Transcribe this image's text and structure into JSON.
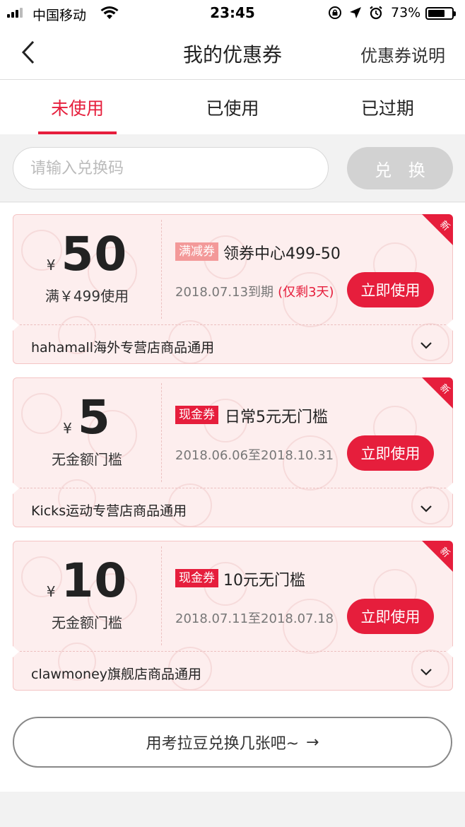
{
  "status_bar": {
    "carrier": "中国移动",
    "time": "23:45",
    "battery_percent": "73%",
    "battery_level": 0.73
  },
  "nav": {
    "title": "我的优惠券",
    "right_label": "优惠券说明",
    "back_icon": "chevron-left-icon"
  },
  "tabs": [
    {
      "label": "未使用",
      "active": true
    },
    {
      "label": "已使用",
      "active": false
    },
    {
      "label": "已过期",
      "active": false
    }
  ],
  "redeem": {
    "placeholder": "请输入兑换码",
    "value": "",
    "button_label": "兑 换"
  },
  "coupons": [
    {
      "currency": "¥",
      "value": "50",
      "condition": "满￥499使用",
      "tag": "满减券",
      "name": "领券中心499-50",
      "validity": "2018.07.13到期",
      "remain": "(仅剩3天)",
      "button_label": "立即使用",
      "scope": "hahamall海外专营店商品通用",
      "badge": "新"
    },
    {
      "currency": "¥",
      "value": "5",
      "condition": "无金额门槛",
      "tag": "现金券",
      "name": "日常5元无门槛",
      "validity": "2018.06.06至2018.10.31",
      "remain": "",
      "button_label": "立即使用",
      "scope": "Kicks运动专营店商品通用",
      "badge": "新"
    },
    {
      "currency": "¥",
      "value": "10",
      "condition": "无金额门槛",
      "tag": "现金券",
      "name": "10元无门槛",
      "validity": "2018.07.11至2018.07.18",
      "remain": "",
      "button_label": "立即使用",
      "scope": "clawmoney旗舰店商品通用",
      "badge": "新"
    }
  ],
  "exchange": {
    "label": "用考拉豆兑换几张吧~",
    "arrow": "→"
  },
  "colors": {
    "accent": "#e61e3c",
    "coupon_bg": "#fdeeee",
    "tag_manjian": "#f39999",
    "button_disabled": "#d2d2d2"
  }
}
